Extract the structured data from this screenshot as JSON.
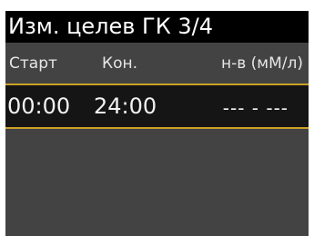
{
  "title": "Изм. целев ГК 3/4",
  "columns": {
    "start": "Старт",
    "end": "Кон.",
    "unit": "н-в (мМ/л)"
  },
  "rows": [
    {
      "start": "00:00",
      "end": "24:00",
      "value": "--- - ---"
    }
  ],
  "colors": {
    "background": "#434343",
    "title_bar": "#000000",
    "selected_row": "#151515",
    "selection_border": "#c9a227",
    "text": "#ffffff"
  }
}
